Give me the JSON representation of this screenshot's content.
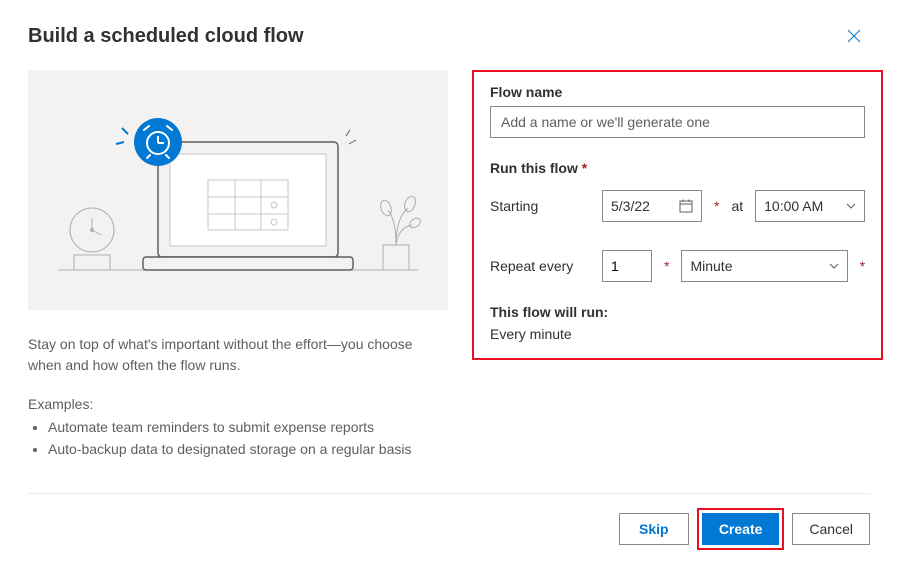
{
  "header": {
    "title": "Build a scheduled cloud flow"
  },
  "left": {
    "description": "Stay on top of what's important without the effort—you choose when and how often the flow runs.",
    "examples_label": "Examples:",
    "examples": [
      "Automate team reminders to submit expense reports",
      "Auto-backup data to designated storage on a regular basis"
    ]
  },
  "form": {
    "flow_name_label": "Flow name",
    "flow_name_placeholder": "Add a name or we'll generate one",
    "flow_name_value": "",
    "run_label": "Run this flow",
    "starting_label": "Starting",
    "starting_date": "5/3/22",
    "at_label": "at",
    "starting_time": "10:00 AM",
    "repeat_label": "Repeat every",
    "repeat_value": "1",
    "repeat_unit": "Minute",
    "summary_label": "This flow will run:",
    "summary_text": "Every minute"
  },
  "footer": {
    "skip": "Skip",
    "create": "Create",
    "cancel": "Cancel"
  },
  "colors": {
    "primary": "#0078d4",
    "highlight_border": "#e81123"
  }
}
